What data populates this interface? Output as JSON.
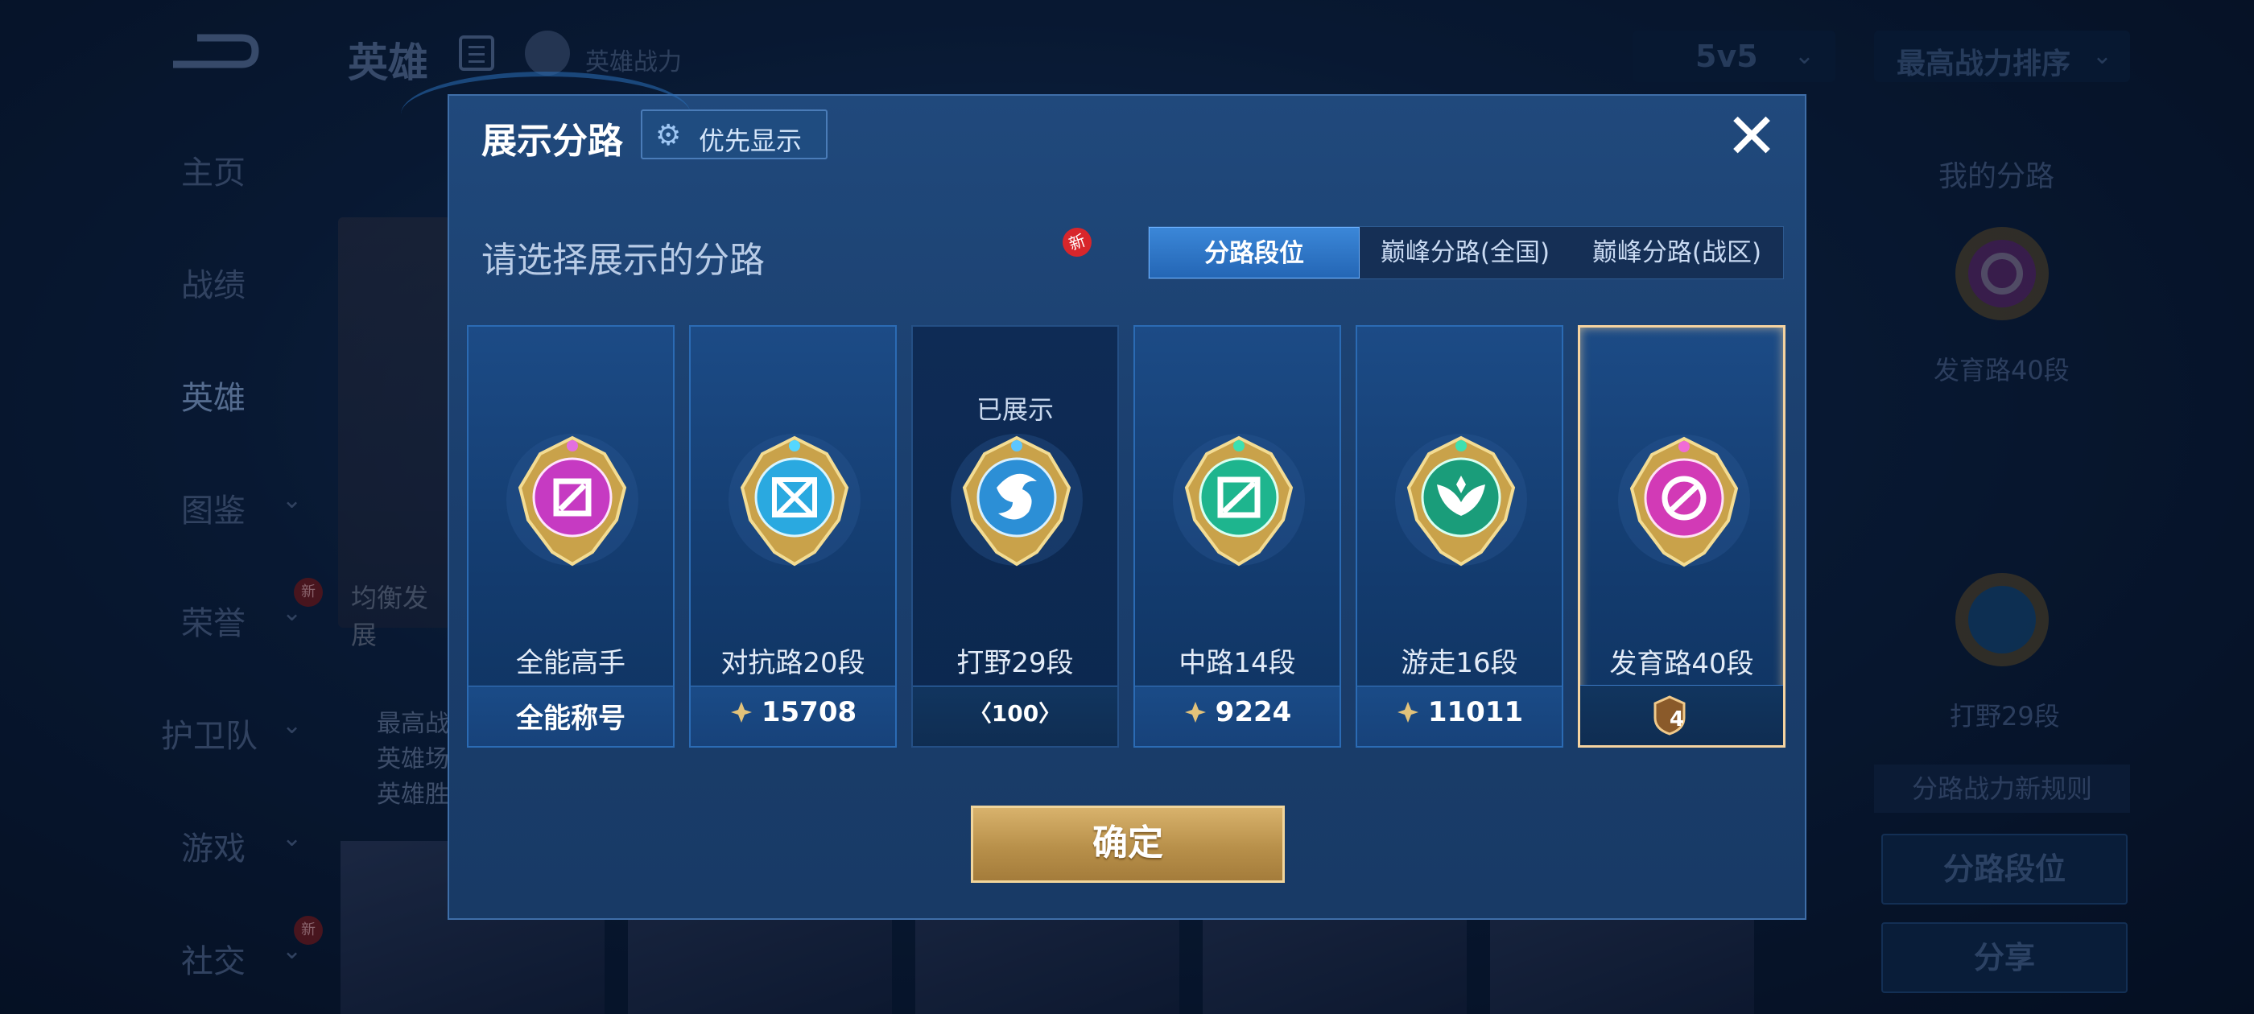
{
  "header": {
    "title": "英雄",
    "power_label": "英雄战力",
    "mode_select": "5v5",
    "sort_select": "最高战力排序"
  },
  "nav": [
    {
      "label": "主页"
    },
    {
      "label": "战绩"
    },
    {
      "label": "英雄"
    },
    {
      "label": "图鉴"
    },
    {
      "label": "荣誉",
      "badge": "新"
    },
    {
      "label": "护卫队"
    },
    {
      "label": "游戏"
    },
    {
      "label": "社交",
      "badge": "新"
    }
  ],
  "background": {
    "hero_card_text": "均衡发展",
    "hero_stats": [
      "最高战",
      "英雄场",
      "英雄胜"
    ]
  },
  "my_lane": {
    "title": "我的分路",
    "primary": "发育路40段",
    "secondary": "打野29段",
    "rule_button": "分路战力新规则",
    "lane_rank_button": "分路段位",
    "share_button": "分享"
  },
  "dialog": {
    "title": "展示分路",
    "priority_button": "优先显示",
    "subtitle": "请选择展示的分路",
    "tabs": [
      {
        "label": "分路段位",
        "active": true
      },
      {
        "label": "巅峰分路(全国)",
        "active": false
      },
      {
        "label": "巅峰分路(战区)",
        "active": false
      }
    ],
    "tab_new_badge": "新",
    "cards": [
      {
        "name": "全能高手",
        "value": "全能称号",
        "icon": "all-round-emblem-icon",
        "color": "#c63ac2"
      },
      {
        "name": "对抗路20段",
        "value": "15708",
        "icon": "clash-lane-emblem-icon",
        "color": "#2aa9e0"
      },
      {
        "name": "打野29段",
        "value": "100",
        "icon": "jungle-emblem-icon",
        "color": "#2c8fd6",
        "status": "已展示"
      },
      {
        "name": "中路14段",
        "value": "9224",
        "icon": "mid-lane-emblem-icon",
        "color": "#1eb58e"
      },
      {
        "name": "游走16段",
        "value": "11011",
        "icon": "roam-emblem-icon",
        "color": "#1a9d7a"
      },
      {
        "name": "发育路40段",
        "value": "4",
        "icon": "farm-lane-emblem-icon",
        "color": "#d23ab6",
        "selected": true
      }
    ],
    "confirm_button": "确定"
  }
}
